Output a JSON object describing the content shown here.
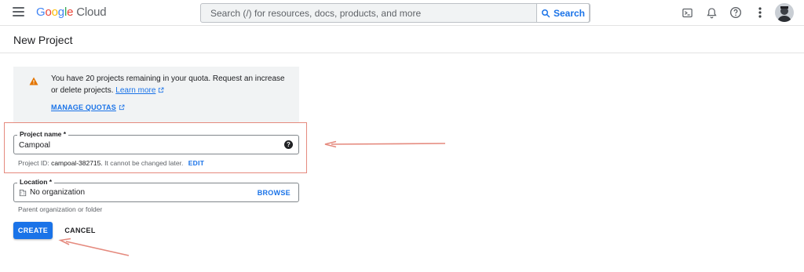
{
  "header": {
    "logo_google": "Google",
    "logo_cloud": "Cloud",
    "search_placeholder": "Search (/) for resources, docs, products, and more",
    "search_button": "Search"
  },
  "page": {
    "title": "New Project"
  },
  "quota": {
    "message": "You have 20 projects remaining in your quota. Request an increase or delete projects.",
    "learn_more": "Learn more",
    "manage_quotas": "MANAGE QUOTAS"
  },
  "project_name": {
    "label": "Project name *",
    "value": "Campoal",
    "help": "?",
    "id_prefix": "Project ID:",
    "id_value": "campoal-382715.",
    "id_suffix": "It cannot be changed later.",
    "edit": "EDIT"
  },
  "location": {
    "label": "Location *",
    "value": "No organization",
    "browse": "BROWSE",
    "hint": "Parent organization or folder"
  },
  "actions": {
    "create": "CREATE",
    "cancel": "CANCEL"
  },
  "colors": {
    "accent": "#1a73e8",
    "annotation": "#e58a7e",
    "warning": "#e37400"
  },
  "icons": [
    "menu-icon",
    "search-icon",
    "cloud-shell-icon",
    "notifications-icon",
    "help-icon",
    "more-vert-icon",
    "warning-icon",
    "external-link-icon",
    "organization-icon"
  ]
}
